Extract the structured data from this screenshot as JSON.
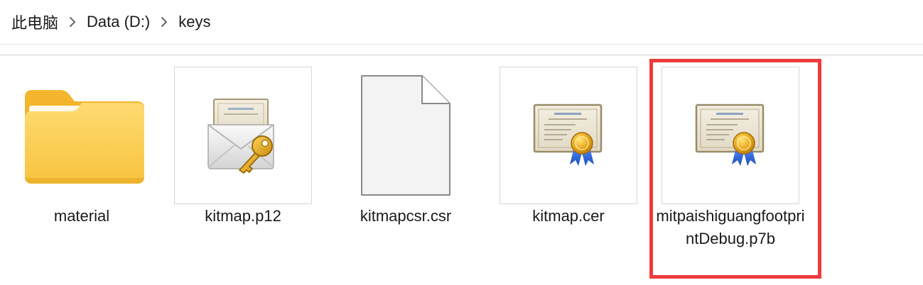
{
  "breadcrumb": {
    "items": [
      {
        "label": "此电脑"
      },
      {
        "label": "Data (D:)"
      },
      {
        "label": "keys"
      }
    ],
    "separator_icon": "chevron-right-icon"
  },
  "files": [
    {
      "name": "material",
      "type": "folder",
      "icon": "folder-icon"
    },
    {
      "name": "kitmap.p12",
      "type": "p12",
      "icon": "personal-certificate-key-icon"
    },
    {
      "name": "kitmapcsr.csr",
      "type": "csr",
      "icon": "blank-file-icon"
    },
    {
      "name": "kitmap.cer",
      "type": "cer",
      "icon": "certificate-icon"
    },
    {
      "name": "mitpaishiguangfootprintDebug.p7b",
      "type": "p7b",
      "icon": "certificate-icon",
      "highlighted": true
    }
  ],
  "colors": {
    "highlight": "#ee3b3b",
    "folder": "#f7c340",
    "certificate_seal": "#e3a21a",
    "ribbon": "#2c63d8"
  }
}
